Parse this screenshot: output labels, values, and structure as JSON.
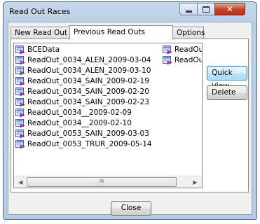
{
  "window": {
    "title": "Read Out Races"
  },
  "tabs": [
    "New Read Out",
    "Previous Read Outs",
    "Options"
  ],
  "list": {
    "column1": [
      "BCEData",
      "ReadOut_0034_ALEN_2009-03-04",
      "ReadOut_0034_ALEN_2009-03-10",
      "ReadOut_0034_SAIN_2009-02-19",
      "ReadOut_0034_SAIN_2009-02-20",
      "ReadOut_0034_SAIN_2009-02-23",
      "ReadOut_0034__2009-02-09",
      "ReadOut_0034__2009-02-10",
      "ReadOut_0053_SAIN_2009-03-03",
      "ReadOut_0053_TRUR_2009-05-14"
    ],
    "column2": [
      "ReadOu",
      "ReadOu"
    ],
    "scroll_thumb_grip": "III"
  },
  "buttons": {
    "quick_view": "Quick View",
    "delete": "Delete",
    "close": "Close"
  },
  "colors": {
    "accent": "#3c7fb1",
    "close_red": "#c7452c"
  }
}
